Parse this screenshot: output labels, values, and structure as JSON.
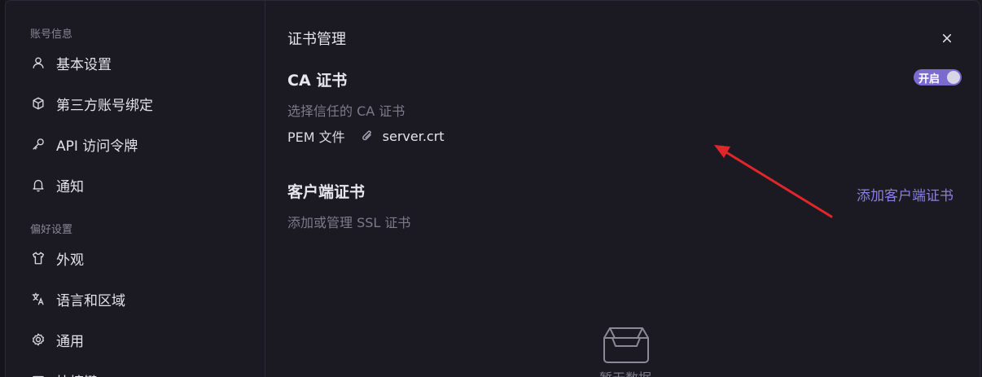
{
  "sidebar": {
    "groups": [
      {
        "label": "账号信息",
        "items": [
          {
            "label": "基本设置",
            "icon": "user-icon"
          },
          {
            "label": "第三方账号绑定",
            "icon": "cube-icon"
          },
          {
            "label": "API 访问令牌",
            "icon": "key-icon"
          },
          {
            "label": "通知",
            "icon": "bell-icon"
          }
        ]
      },
      {
        "label": "偏好设置",
        "items": [
          {
            "label": "外观",
            "icon": "shirt-icon"
          },
          {
            "label": "语言和区域",
            "icon": "translate-icon"
          },
          {
            "label": "通用",
            "icon": "gear-icon"
          },
          {
            "label": "快捷键",
            "icon": "keyboard-icon"
          }
        ]
      }
    ]
  },
  "main": {
    "title": "证书管理",
    "ca": {
      "title": "CA 证书",
      "description": "选择信任的 CA 证书",
      "toggle_label": "开启",
      "toggle_on": true,
      "pem_label": "PEM 文件",
      "file_name": "server.crt"
    },
    "client": {
      "title": "客户端证书",
      "description": "添加或管理 SSL 证书",
      "add_label": "添加客户端证书"
    },
    "empty_text": "暂无数据"
  },
  "colors": {
    "accent": "#7b6bd0",
    "link": "#8b7ee0",
    "annotation_arrow": "#e0262b"
  }
}
